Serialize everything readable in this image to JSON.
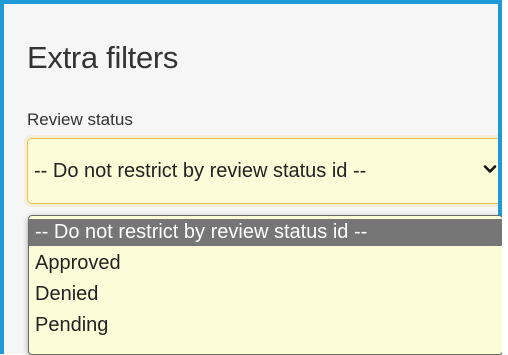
{
  "panel": {
    "title": "Extra filters"
  },
  "review_status": {
    "label": "Review status",
    "selected_value": "-- Do not restrict by review status id --",
    "chevron_icon": "chevron-down-icon",
    "options": [
      {
        "label": "-- Do not restrict by review status id --",
        "selected": true
      },
      {
        "label": "Approved",
        "selected": false
      },
      {
        "label": "Denied",
        "selected": false
      },
      {
        "label": "Pending",
        "selected": false
      }
    ]
  },
  "colors": {
    "panel_border": "#1e9bd7",
    "panel_background": "#f6f6f6",
    "select_background": "#fdfcd9",
    "select_border": "#e8c44c",
    "option_selected_background": "#767676"
  }
}
